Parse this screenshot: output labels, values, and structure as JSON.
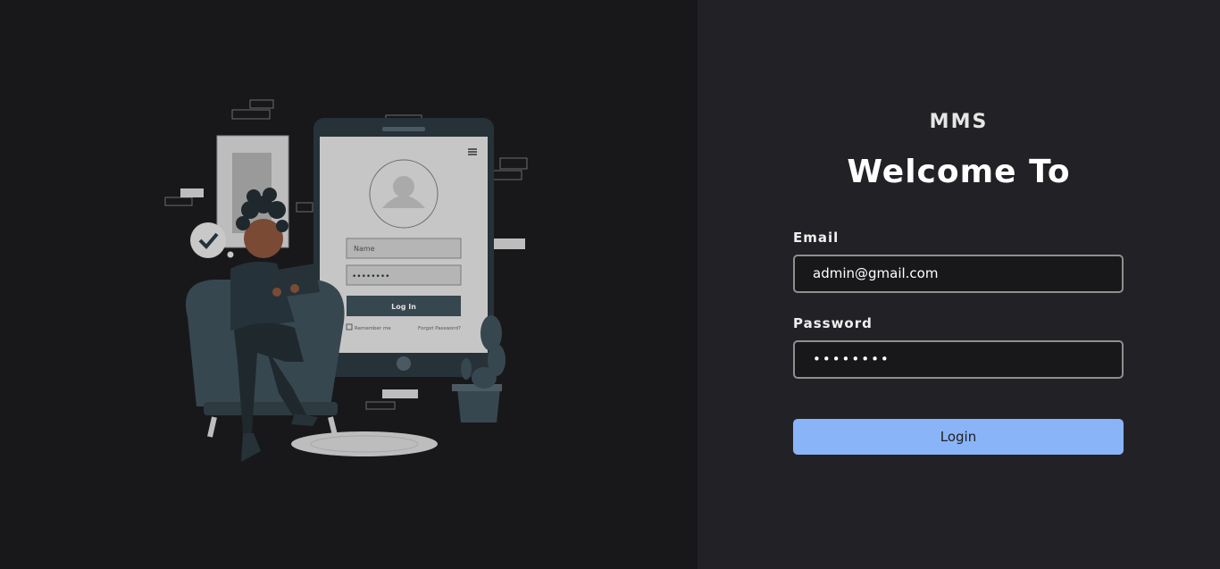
{
  "brand": "MMS",
  "welcome": "Welcome To",
  "form": {
    "email_label": "Email",
    "email_value": "admin@gmail.com",
    "password_label": "Password",
    "password_value": "••••••••",
    "login_label": "Login"
  },
  "illustration": {
    "phone_name_placeholder": "Name",
    "phone_password_dots": "••••••••",
    "phone_login_button": "Log In",
    "phone_remember": "Remember me",
    "phone_forgot": "Forgot Password?"
  },
  "colors": {
    "accent": "#8ab4f8",
    "left_bg": "#18181b",
    "right_bg": "#222226"
  }
}
